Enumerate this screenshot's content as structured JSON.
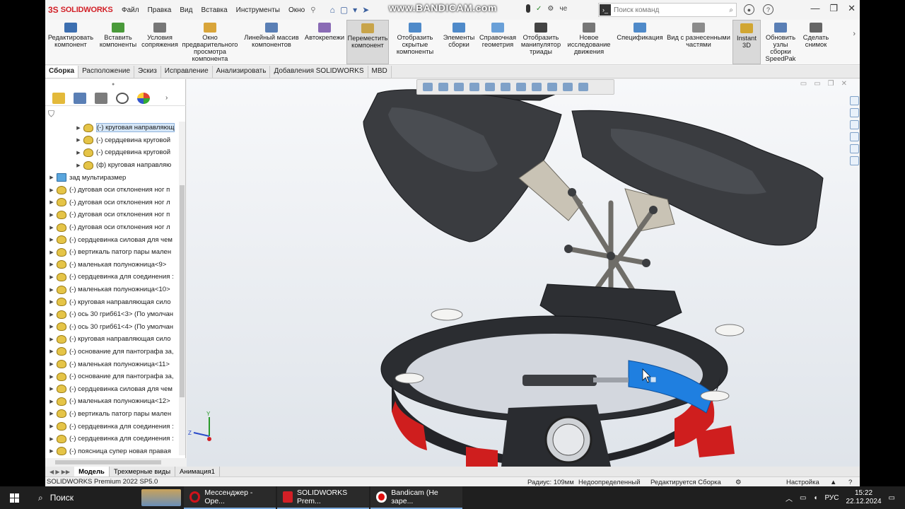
{
  "app": {
    "logo_ds": "3S",
    "logo_text": "SOLIDWORKS",
    "menu": [
      "Файл",
      "Правка",
      "Вид",
      "Вставка",
      "Инструменты",
      "Окно"
    ],
    "bandicam": "www.BANDICAM.com",
    "user_short": "че",
    "search_placeholder": "Поиск команд"
  },
  "ribbon": [
    {
      "label": "Редактировать компонент",
      "color": "#3d6fb0"
    },
    {
      "label": "Вставить компоненты",
      "color": "#4a9a3a"
    },
    {
      "label": "Условия сопряжения",
      "color": "#777777"
    },
    {
      "label": "Окно предварительного просмотра компонента",
      "color": "#d9a53a"
    },
    {
      "label": "Линейный массив компонентов",
      "color": "#5a7fb5"
    },
    {
      "label": "Автокрепежи",
      "color": "#8a6bb5"
    },
    {
      "label": "Переместить компонент",
      "color": "#c8a44a",
      "active": true
    },
    {
      "label": "Отобразить скрытые компоненты",
      "color": "#4f8ac9"
    },
    {
      "label": "Элементы сборки",
      "color": "#4f8ac9"
    },
    {
      "label": "Справочная геометрия",
      "color": "#6aa0d8"
    },
    {
      "label": "Отобразить манипулятор триады",
      "color": "#444444"
    },
    {
      "label": "Новое исследование движения",
      "color": "#777777"
    },
    {
      "label": "Спецификация",
      "color": "#4f8ac9"
    },
    {
      "label": "Вид с разнесенными частями",
      "color": "#8c8c8c"
    },
    {
      "label": "Instant 3D",
      "color": "#d1a632",
      "active": true
    },
    {
      "label": "Обновить узлы сборки SpeedPak",
      "color": "#5a7fb5"
    },
    {
      "label": "Сделать снимок",
      "color": "#666666"
    }
  ],
  "tabs": [
    "Сборка",
    "Расположение",
    "Эскиз",
    "Исправление",
    "Анализировать",
    "Добавления SOLIDWORKS",
    "MBD"
  ],
  "tree": [
    {
      "text": "(-) круговая направляющ",
      "indent": 2,
      "sel": true,
      "type": "part"
    },
    {
      "text": "(-) сердцевина круговой",
      "indent": 2,
      "type": "part"
    },
    {
      "text": "(-) сердцевина круговой",
      "indent": 2,
      "type": "part"
    },
    {
      "text": "(ф) круговая направляю",
      "indent": 2,
      "type": "part"
    },
    {
      "text": "зад мультиразмер",
      "indent": 1,
      "type": "folder"
    },
    {
      "text": "(-) дуговая оси отклонения ног п",
      "indent": 1,
      "type": "part"
    },
    {
      "text": "(-) дуговая оси отклонения ног л",
      "indent": 1,
      "type": "part"
    },
    {
      "text": "(-) дуговая оси отклонения ног п",
      "indent": 1,
      "type": "part"
    },
    {
      "text": "(-) дуговая оси отклонения ног л",
      "indent": 1,
      "type": "part"
    },
    {
      "text": "(-) сердцевинка силовая  для чем",
      "indent": 1,
      "type": "part"
    },
    {
      "text": "(-) вертикаль патогр пары мален",
      "indent": 1,
      "type": "part"
    },
    {
      "text": "(-) маленькая полуножница<9>",
      "indent": 1,
      "type": "part"
    },
    {
      "text": "(-) сердцевинка для соединения :",
      "indent": 1,
      "type": "part"
    },
    {
      "text": "(-) маленькая полуножница<10>",
      "indent": 1,
      "type": "part"
    },
    {
      "text": "(-) круговая направляющая сило",
      "indent": 1,
      "type": "part"
    },
    {
      "text": "(-) ось 30 гриб61<3> (По умолчан",
      "indent": 1,
      "type": "part"
    },
    {
      "text": "(-) ось 30 гриб61<4> (По умолчан",
      "indent": 1,
      "type": "part"
    },
    {
      "text": "(-) круговая направляющая сило",
      "indent": 1,
      "type": "part"
    },
    {
      "text": "(-) основание для пантографа за,",
      "indent": 1,
      "type": "part"
    },
    {
      "text": "(-) маленькая полуножница<11>",
      "indent": 1,
      "type": "part"
    },
    {
      "text": "(-) основание для пантографа за,",
      "indent": 1,
      "type": "part"
    },
    {
      "text": "(-) сердцевинка силовая  для чем",
      "indent": 1,
      "type": "part"
    },
    {
      "text": "(-) маленькая полуножница<12>",
      "indent": 1,
      "type": "part"
    },
    {
      "text": "(-) вертикаль патогр пары мален",
      "indent": 1,
      "type": "part"
    },
    {
      "text": "(-) сердцевинка для соединения :",
      "indent": 1,
      "type": "part"
    },
    {
      "text": "(-) сердцевинка для соединения :",
      "indent": 1,
      "type": "part"
    },
    {
      "text": "(-) поясница супер новая правая",
      "indent": 1,
      "type": "part"
    }
  ],
  "bottom_tabs": [
    "Модель",
    "Трехмерные виды",
    "Анимация1"
  ],
  "status": {
    "product": "SOLIDWORKS Premium 2022 SP5.0",
    "radius": "Радиус: 109мм",
    "state": "Недоопределенный",
    "editing": "Редактируется Сборка",
    "settings": "Настройка"
  },
  "triad": {
    "y": "Y",
    "z": "Z"
  },
  "taskbar": {
    "search": "Поиск",
    "apps": [
      {
        "label": "Мессенджер - Ope...",
        "color": "#d0121b"
      },
      {
        "label": "SOLIDWORKS Prem...",
        "color": "#d21f26"
      },
      {
        "label": "Bandicam (Не заре...",
        "color": "#e01010"
      }
    ],
    "lang": "РУС",
    "time": "15:22",
    "date": "22.12.2024"
  }
}
